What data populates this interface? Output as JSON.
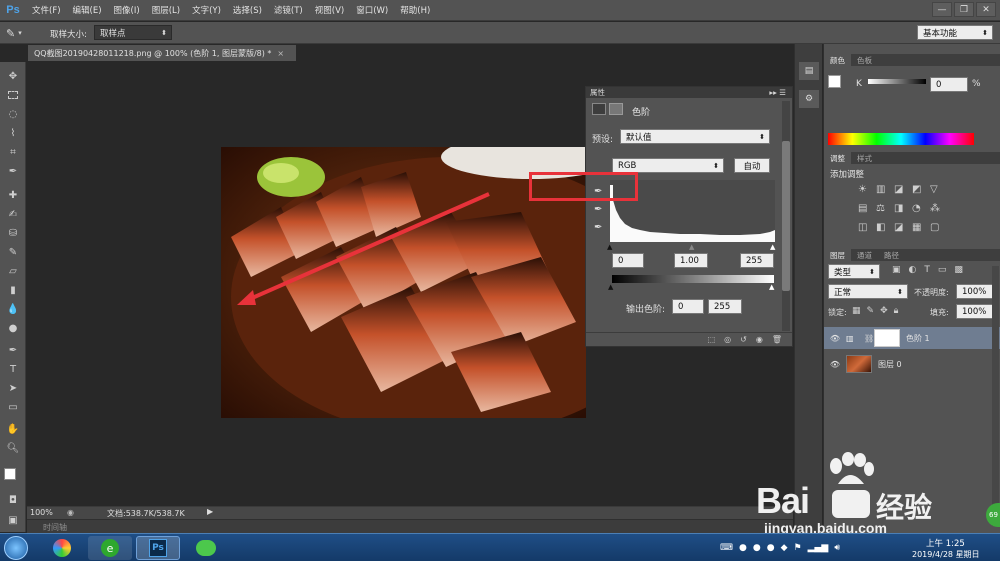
{
  "app": {
    "logo": "Ps"
  },
  "menu": [
    "文件(F)",
    "编辑(E)",
    "图像(I)",
    "图层(L)",
    "文字(Y)",
    "选择(S)",
    "滤镜(T)",
    "视图(V)",
    "窗口(W)",
    "帮助(H)"
  ],
  "window_controls": [
    "—",
    "❐",
    "✕"
  ],
  "options_bar": {
    "sample_size_label": "取样大小:",
    "sample_size_value": "取样点",
    "workspace": "基本功能"
  },
  "document_tab": {
    "title": "QQ截图20190428011218.png @ 100% (色阶 1, 图层蒙版/8) *",
    "close": "×"
  },
  "status": {
    "zoom": "100%",
    "doc_info": "文档:538.7K/538.7K"
  },
  "timeline": {
    "label": "时间轴"
  },
  "properties": {
    "panel_title": "属性",
    "adjustment_name": "色阶",
    "preset_label": "预设:",
    "preset_value": "默认值",
    "channel": "RGB",
    "auto_button": "自动",
    "input_levels": {
      "black": "0",
      "gamma": "1.00",
      "white": "255"
    },
    "output_label": "输出色阶:",
    "output_levels": {
      "black": "0",
      "white": "255"
    }
  },
  "color_panel": {
    "tabs": [
      "颜色",
      "色板"
    ],
    "channel_label": "K",
    "value": "0",
    "unit": "%"
  },
  "adjustments_panel": {
    "tabs": [
      "调整",
      "样式"
    ],
    "heading": "添加调整"
  },
  "layers_panel": {
    "tabs": [
      "图层",
      "通道",
      "路径"
    ],
    "filter": "类型",
    "blend_mode": "正常",
    "opacity_label": "不透明度:",
    "opacity_value": "100%",
    "lock_label": "锁定:",
    "fill_label": "填充:",
    "fill_value": "100%",
    "layers": [
      {
        "name": "色阶 1",
        "selected": true
      },
      {
        "name": "图层 0",
        "selected": false
      }
    ]
  },
  "taskbar": {
    "time": "上午 1:25",
    "date": "2019/4/28 星期日",
    "ps_label": "Ps"
  },
  "watermark": {
    "brand": "Bai",
    "brand_cn": "经验",
    "url": "jingyan.baidu.com"
  },
  "badge": {
    "value": "69"
  },
  "colors": {
    "accent_red": "#e8323a",
    "ps_blue": "#4fa3e8",
    "panel": "#535353",
    "canvas": "#282828"
  }
}
